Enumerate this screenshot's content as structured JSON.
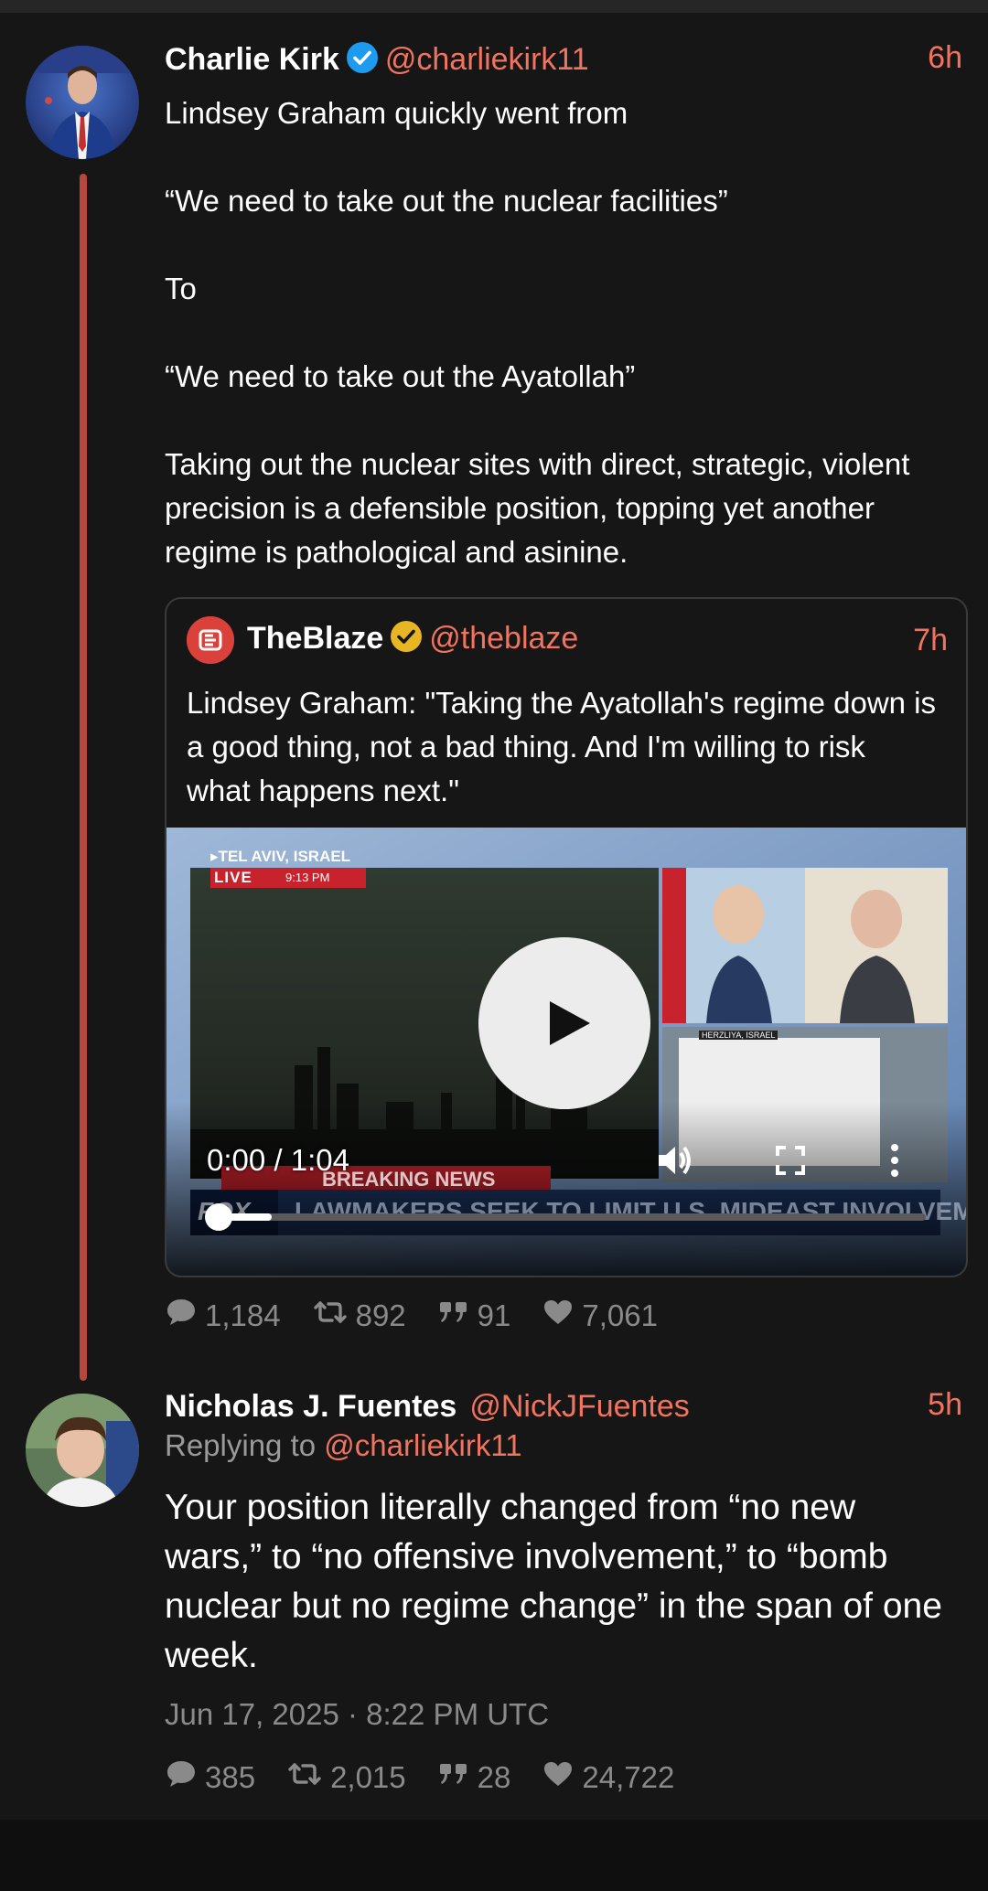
{
  "tweets": [
    {
      "fullname": "Charlie Kirk",
      "handle": "@charliekirk11",
      "time": "6h",
      "text": "Lindsey Graham quickly went from\n\n“We need to take out the nuclear facilities”\n\nTo\n\n“We need to take out the Ayatollah”\n\nTaking out the nuclear sites with direct, strategic, violent precision is a defensible position, topping yet another regime is pathological and asinine.",
      "quote": {
        "fullname": "TheBlaze",
        "handle": "@theblaze",
        "time": "7h",
        "text": "Lindsey Graham: \"Taking the Ayatollah's regime down is a good thing, not a bad thing. And I'm willing to risk what happens next.\"",
        "video": {
          "location": "▸TEL AVIV, ISRAEL",
          "live": "LIVE",
          "live_time": "9:13 PM",
          "breaking": "BREAKING NEWS",
          "network": "FOX",
          "headline": "LAWMAKERS SEEK TO LIMIT U.S. MIDEAST INVOLVEMENT",
          "inset_label": "HERZLIYA, ISRAEL",
          "time_display": "0:00 / 1:04",
          "progress": 0.09
        }
      },
      "stats": {
        "comments": "1,184",
        "retweets": "892",
        "quotes": "91",
        "likes": "7,061"
      }
    },
    {
      "fullname": "Nicholas J. Fuentes",
      "handle": "@NickJFuentes",
      "time": "5h",
      "replying_prefix": "Replying to",
      "replying_handle": "@charliekirk11",
      "text": "Your position literally changed from “no new wars,” to “no offensive involvement,” to “bomb nuclear but no regime change” in the span of one week.",
      "date": "Jun 17, 2025 · 8:22 PM UTC",
      "stats": {
        "comments": "385",
        "retweets": "2,015",
        "quotes": "28",
        "likes": "24,722"
      }
    }
  ],
  "colors": {
    "background": "#161616",
    "accent": "#f2735e",
    "thread_line": "#b8473e",
    "muted": "#8a8a8a",
    "verified_blue": "#1d9bf0",
    "verified_gold": "#e8b623"
  },
  "icons": [
    "verified-badge-icon",
    "comment-icon",
    "retweet-icon",
    "quote-icon",
    "heart-icon",
    "play-icon",
    "volume-icon",
    "fullscreen-icon",
    "more-vertical-icon"
  ]
}
